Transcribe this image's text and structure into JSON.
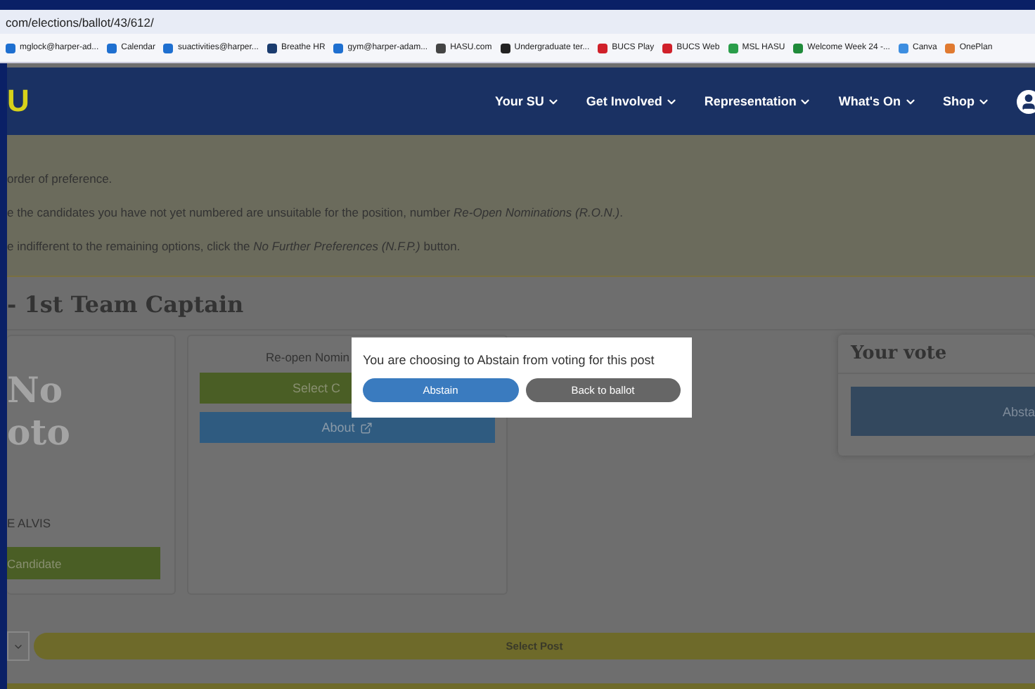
{
  "address_bar": {
    "url": "com/elections/ballot/43/612/"
  },
  "bookmarks": [
    {
      "label": "mglock@harper-ad...",
      "color": "#1e6fd0"
    },
    {
      "label": "Calendar",
      "color": "#1e6fd0"
    },
    {
      "label": "suactivities@harper...",
      "color": "#1e6fd0"
    },
    {
      "label": "Breathe HR",
      "color": "#1a3b6e"
    },
    {
      "label": "gym@harper-adam...",
      "color": "#1e6fd0"
    },
    {
      "label": "HASU.com",
      "color": "#444444"
    },
    {
      "label": "Undergraduate ter...",
      "color": "#222222"
    },
    {
      "label": "BUCS Play",
      "color": "#d0202a"
    },
    {
      "label": "BUCS Web",
      "color": "#d0202a"
    },
    {
      "label": "MSL HASU",
      "color": "#2a9d4a"
    },
    {
      "label": "Welcome Week 24 -...",
      "color": "#1f8a3a"
    },
    {
      "label": "Canva",
      "color": "#3c8de0"
    },
    {
      "label": "OnePlan",
      "color": "#e07a30"
    }
  ],
  "site_nav": {
    "logo": "U",
    "items": [
      "Your SU",
      "Get Involved",
      "Representation",
      "What's On",
      "Shop"
    ]
  },
  "instructions": [
    "order of preference.",
    "e the candidates you have not yet numbered are unsuitable for the position, number *Re-Open Nominations (R.O.N.)*.",
    "e indifferent to the remaining options, click the *No Further Preferences (N.F.P.)* button."
  ],
  "post_title": "- 1st Team Captain",
  "candidate_card": {
    "photo_lines": [
      "No",
      "oto"
    ],
    "name": "E ALVIS",
    "button": "Candidate"
  },
  "ron_card": {
    "title": "Re-open Nomin",
    "select_button": "Select C",
    "about_button": "About"
  },
  "vote_card": {
    "title": "Your vote",
    "choice": "Absta"
  },
  "footer_bar": {
    "button": "Select Post"
  },
  "modal": {
    "message": "You are choosing to Abstain from voting for this post",
    "buttons": [
      {
        "label": "Abstain",
        "kind": "primary"
      },
      {
        "label": "Back to ballot",
        "kind": "secondary"
      }
    ]
  }
}
